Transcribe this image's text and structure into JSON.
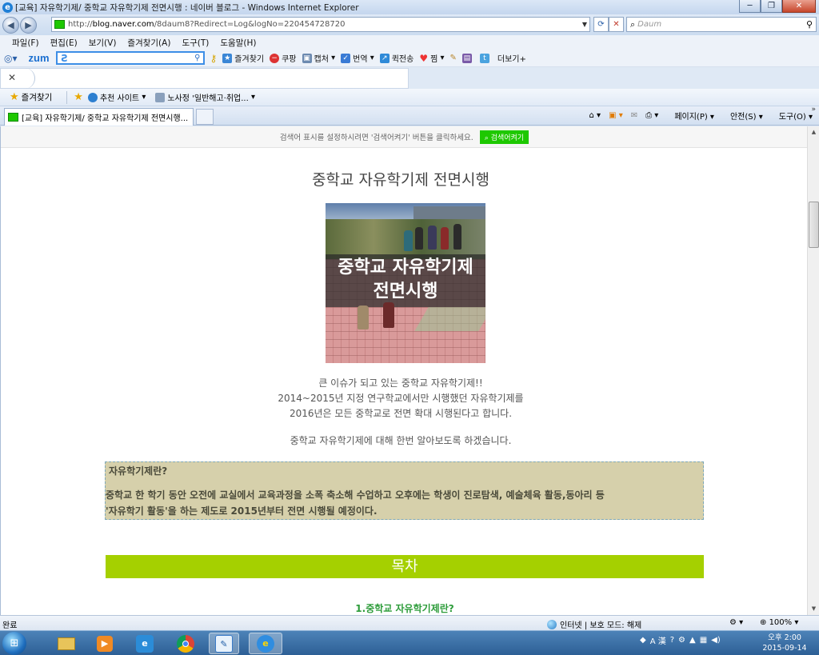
{
  "window": {
    "title": "[교육] 자유학기제/ 중학교 자유학기제 전면시행 : 네이버 블로그 - Windows Internet Explorer",
    "minimize_glyph": "─",
    "maximize_glyph": "❐",
    "close_glyph": "✕"
  },
  "address": {
    "url_prefix": "http://",
    "url_host": "blog.naver.com",
    "url_path": "/8daum8?Redirect=Log&logNo=220454728720",
    "refresh_glyph": "⟳",
    "stop_glyph": "✕",
    "search_placeholder": "Daum"
  },
  "menu": {
    "items": [
      "파일(F)",
      "편집(E)",
      "보기(V)",
      "즐겨찾기(A)",
      "도구(T)",
      "도움말(H)"
    ]
  },
  "zum_toolbar": {
    "logo": "zum",
    "input_value": "Ƨ",
    "items": [
      "즐겨찾기",
      "쿠팡",
      "캡처",
      "번역",
      "퀵전송",
      "찜",
      "더보기+"
    ]
  },
  "favorites_bar": {
    "label": "즐겨찾기",
    "items": [
      "추천 사이트",
      "노사정 '일반해고·취업..."
    ]
  },
  "tabs": {
    "active_title": "[교육] 자유학기제/ 중학교 자유학기제 전면시행...",
    "commands": [
      "페이지(P)",
      "안전(S)",
      "도구(O)"
    ]
  },
  "page": {
    "notice": "검색어 표시를 설정하시려면 '검색어켜기' 버튼을 클릭하세요.",
    "notice_button": "검색어켜기",
    "post_title": "중학교 자유학기제 전면시행",
    "image_caption_line1": "중학교 자유학기제",
    "image_caption_line2": "전면시행",
    "intro_line1": "큰 이슈가 되고 있는 중학교 자유학기제!!",
    "intro_line2": "2014~2015년 지정 연구학교에서만 시행했던 자유학기제를",
    "intro_line3": "2016년은 모든 중학교로 전면 확대 시행된다고 합니다.",
    "intro_line4": "중학교 자유학기제에 대해 한번 알아보도록 하겠습니다.",
    "definition_heading": "자유학기제란?",
    "definition_line1": "중학교 한 학기 동안 오전에 교실에서 교육과정을 소폭 축소해 수업하고 오후에는 학생이 진로탐색, 예술체육 활동,동아리 등",
    "definition_line2": "'자유학기 활동'을 하는 제도로 2015년부터 전면 시행될 예정이다.",
    "toc_title": "목차",
    "toc_item1": "1.중학교 자유학기제란?"
  },
  "statusbar": {
    "done": "완료",
    "zone": "인터넷 | 보호 모드: 해제",
    "zoom": "100%"
  },
  "taskbar": {
    "clock_time": "오후 2:00",
    "clock_date": "2015-09-14",
    "ime": "A 漢"
  },
  "colors": {
    "naver_green": "#1ec800",
    "toc_bar": "#a5d000",
    "definition_bg": "#d6d0ab",
    "toc_item_text": "#2d9c3a"
  }
}
